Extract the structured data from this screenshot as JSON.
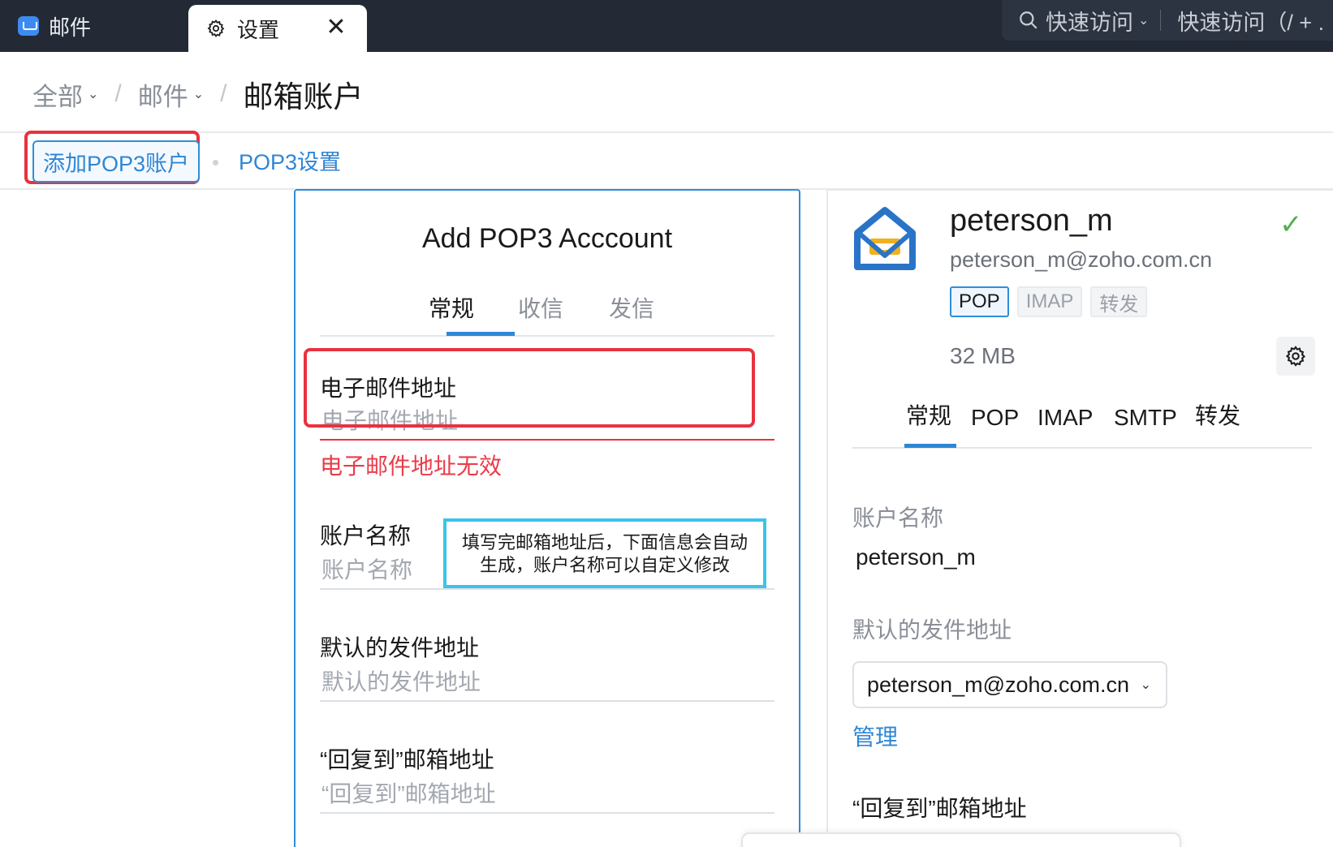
{
  "window_tabs": [
    {
      "label": "邮件"
    },
    {
      "label": "设置",
      "close": "✕"
    }
  ],
  "quick_access": {
    "label": "快速访问",
    "search_placeholder": "快速访问（/ + ."
  },
  "breadcrumb": {
    "items": [
      "全部",
      "邮件"
    ],
    "current": "邮箱账户"
  },
  "subnav": {
    "add_pop3_button": "添加POP3账户",
    "pop3_settings_link": "POP3设置"
  },
  "add_form": {
    "title": "Add POP3 Acccount",
    "tabs": [
      "常规",
      "收信",
      "发信"
    ],
    "active_tab": 0,
    "email": {
      "label": "电子邮件地址",
      "placeholder": "电子邮件地址",
      "error": "电子邮件地址无效"
    },
    "account_name": {
      "label": "账户名称",
      "placeholder": "账户名称"
    },
    "default_from": {
      "label": "默认的发件地址",
      "placeholder": "默认的发件地址"
    },
    "reply_to": {
      "label": "“回复到”邮箱地址",
      "placeholder": "“回复到”邮箱地址"
    },
    "hint": {
      "line1": "填写完邮箱地址后，下面信息会自动",
      "line2": "生成，账户名称可以自定义修改"
    }
  },
  "account": {
    "name": "peterson_m",
    "email": "peterson_m@zoho.com.cn",
    "badges": [
      "POP",
      "IMAP",
      "转发"
    ],
    "active_badge": 0,
    "storage": "32 MB",
    "tabs": [
      "常规",
      "POP",
      "IMAP",
      "SMTP",
      "转发"
    ],
    "active_tab": 0,
    "account_name_label": "账户名称",
    "account_name_value": "peterson_m",
    "default_from_label": "默认的发件地址",
    "default_from_value": "peterson_m@zoho.com.cn",
    "manage_link": "管理",
    "reply_to_label": "“回复到”邮箱地址"
  },
  "colors": {
    "accent": "#2f86d4",
    "error": "#ea3c4a",
    "annotation_red": "#e8323f",
    "annotation_cyan": "#3cc3ea",
    "verified": "#55b04f",
    "topbar": "#232a36"
  },
  "icons": [
    "mail-app-icon",
    "gear-icon",
    "close-icon",
    "search-icon",
    "chevron-down-icon",
    "zoho-mail-logo-icon",
    "check-icon"
  ]
}
